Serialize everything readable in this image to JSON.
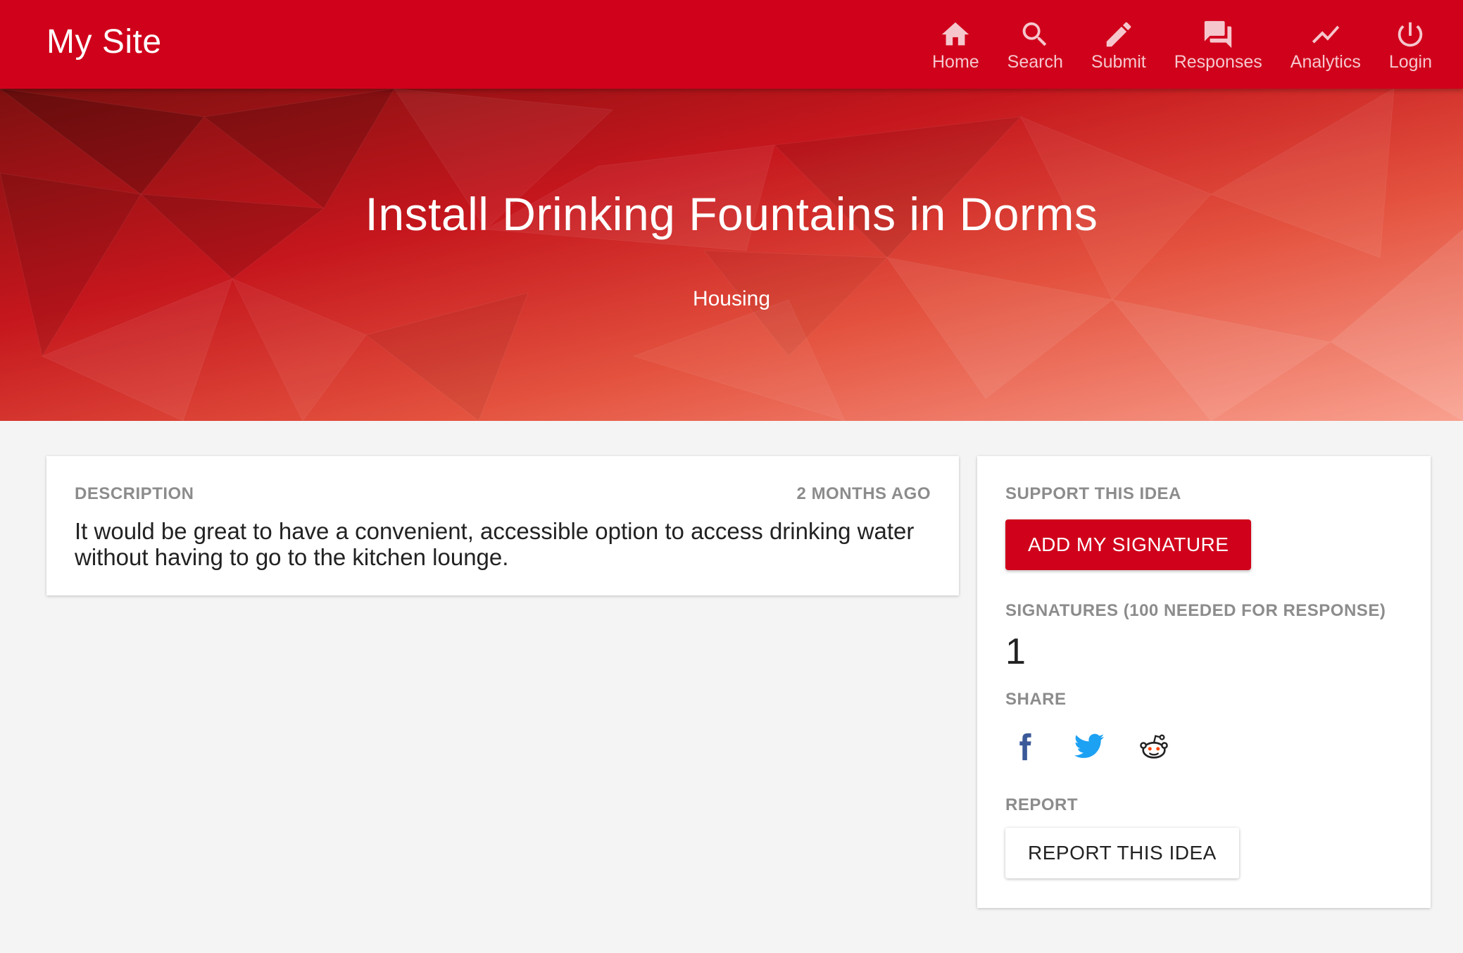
{
  "header": {
    "brand": "My Site",
    "nav": [
      {
        "label": "Home",
        "icon": "home-icon"
      },
      {
        "label": "Search",
        "icon": "search-icon"
      },
      {
        "label": "Submit",
        "icon": "pencil-icon"
      },
      {
        "label": "Responses",
        "icon": "chat-bubbles-icon"
      },
      {
        "label": "Analytics",
        "icon": "trend-line-icon"
      },
      {
        "label": "Login",
        "icon": "power-icon"
      }
    ]
  },
  "hero": {
    "title": "Install Drinking Fountains in Dorms",
    "category": "Housing"
  },
  "description": {
    "label": "DESCRIPTION",
    "timestamp": "2 MONTHS AGO",
    "text": "It would be great to have a convenient, accessible option to access drinking water without having to go to the kitchen lounge."
  },
  "sidebar": {
    "support_label": "SUPPORT THIS IDEA",
    "sign_button": "ADD MY SIGNATURE",
    "signatures_label": "SIGNATURES (100 NEEDED FOR RESPONSE)",
    "signature_count": "1",
    "share_label": "SHARE",
    "share": [
      "facebook-icon",
      "twitter-icon",
      "reddit-icon"
    ],
    "report_label": "REPORT",
    "report_button": "REPORT THIS IDEA"
  },
  "colors": {
    "brand": "#d0021b",
    "background": "#f4f4f4",
    "facebook": "#3b5998",
    "twitter": "#1da1f2"
  }
}
